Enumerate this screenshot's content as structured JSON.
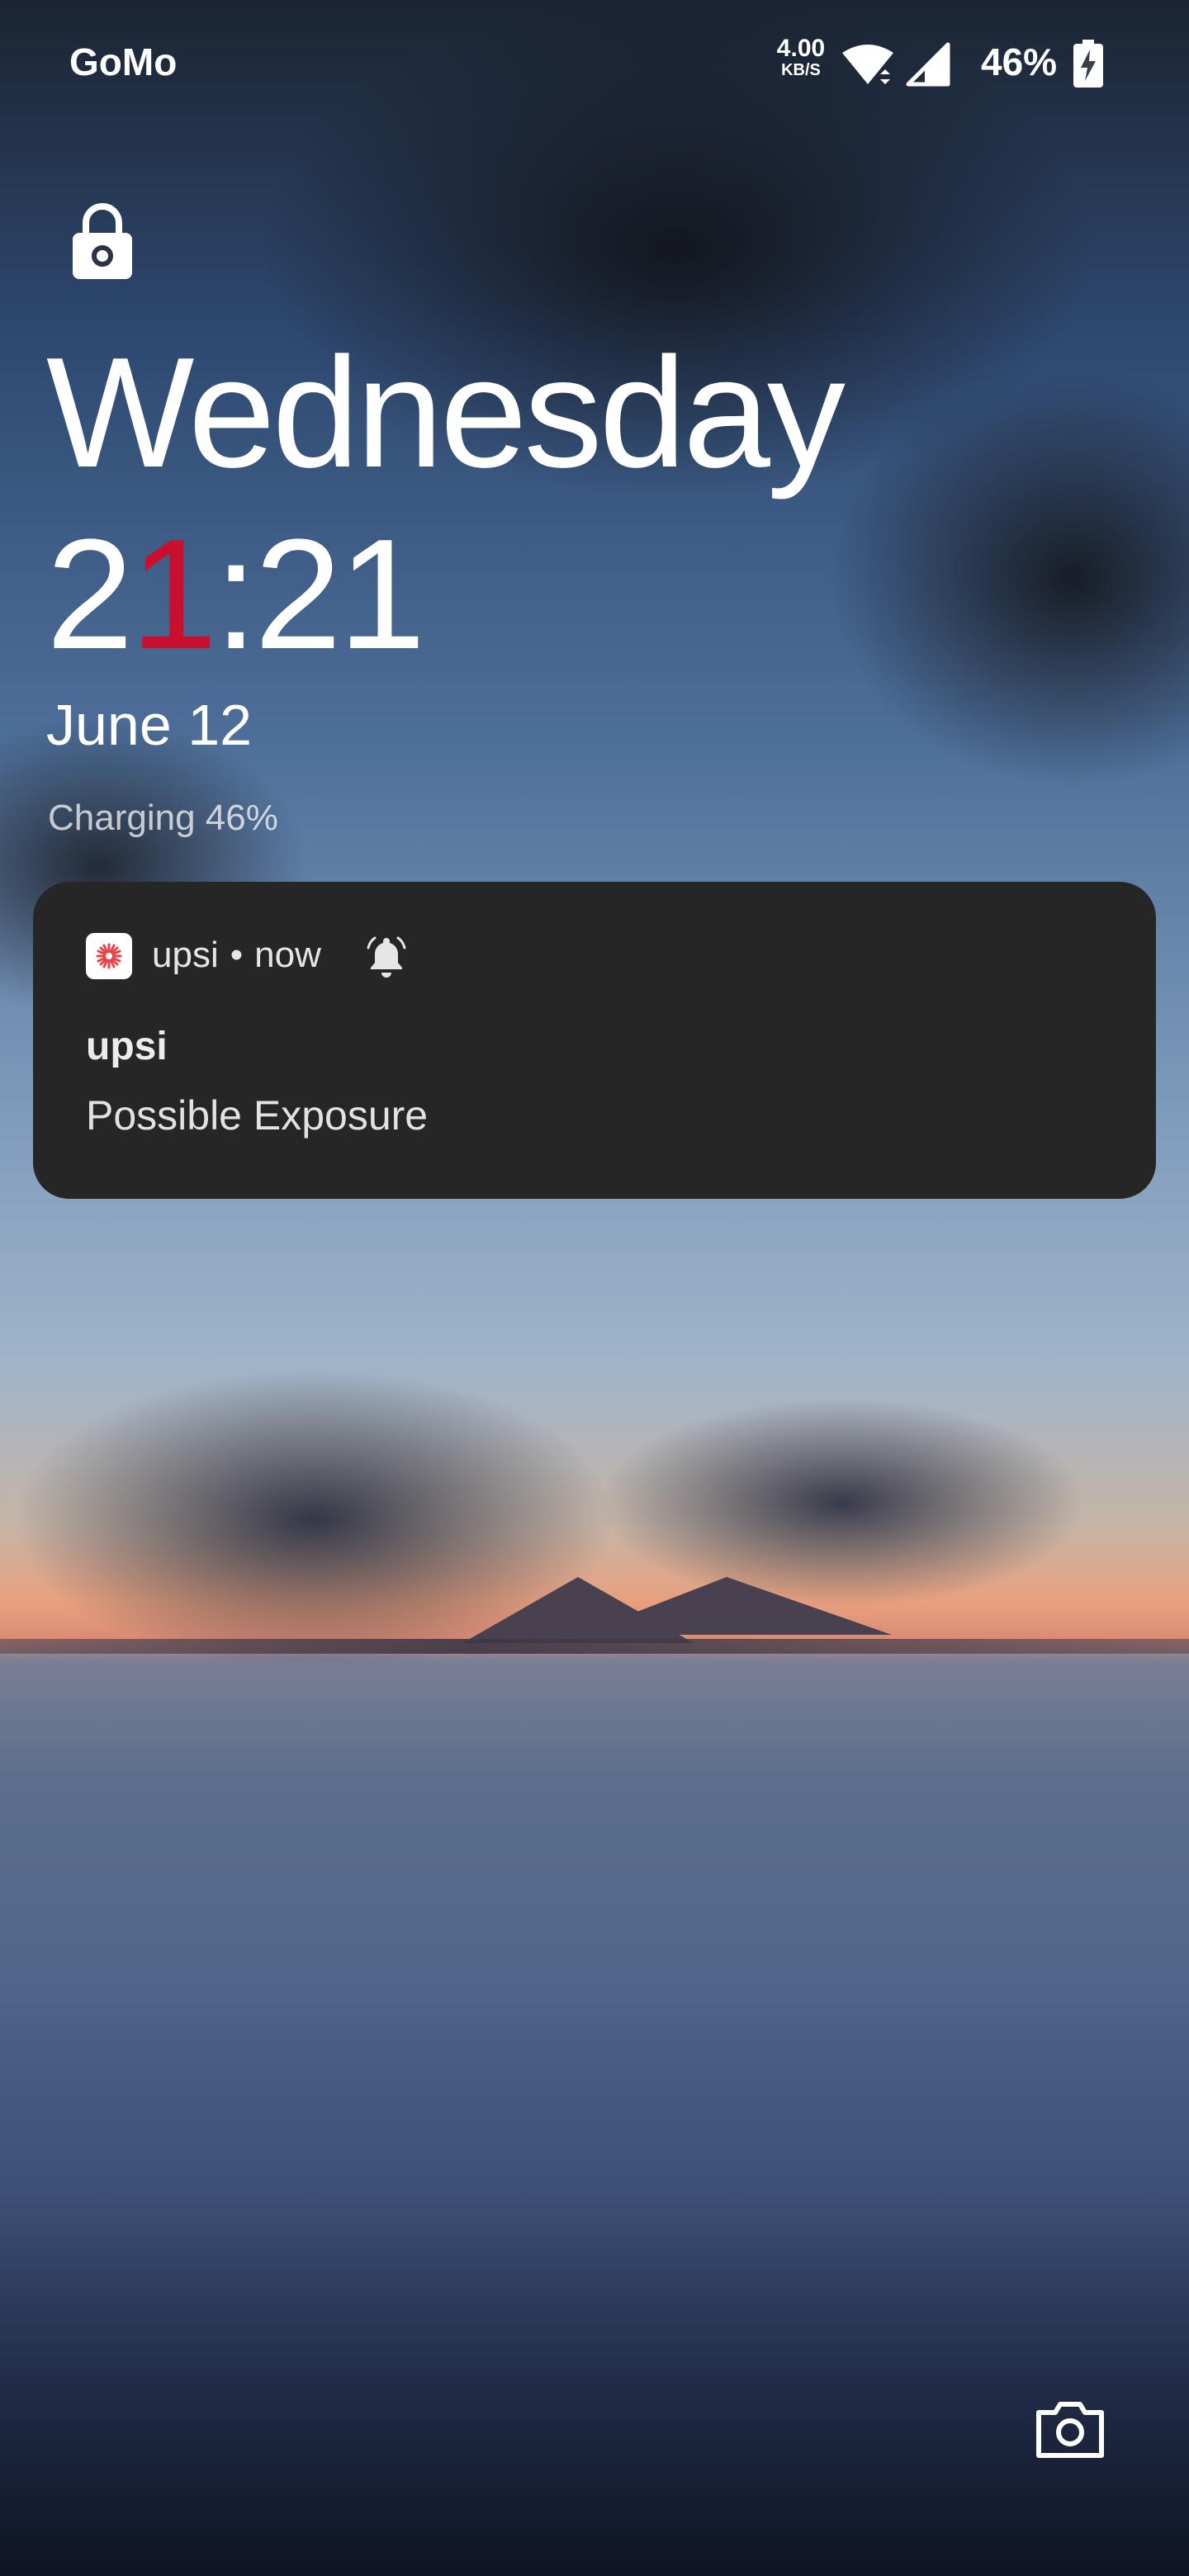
{
  "statusbar": {
    "carrier": "GoMo",
    "net_speed_value": "4.00",
    "net_speed_unit": "KB/S",
    "battery_percent": "46%",
    "icons": [
      "wifi-icon",
      "signal-icon",
      "battery-charging-icon"
    ]
  },
  "lockscreen": {
    "lock_icon": "lock-icon",
    "day": "Wednesday",
    "time_hour_first": "2",
    "time_hour_accent": "1",
    "time_rest": ":21",
    "date": "June 12",
    "charging": "Charging 46%"
  },
  "notification": {
    "app_name": "upsi",
    "separator": "•",
    "time": "now",
    "icon": "bell-icon",
    "title": "upsi",
    "text": "Possible Exposure",
    "accent_color": "#e8434a"
  },
  "shortcuts": {
    "camera_icon": "camera-icon"
  },
  "colors": {
    "clock_accent": "#c8102e",
    "notification_bg": "#262626"
  }
}
